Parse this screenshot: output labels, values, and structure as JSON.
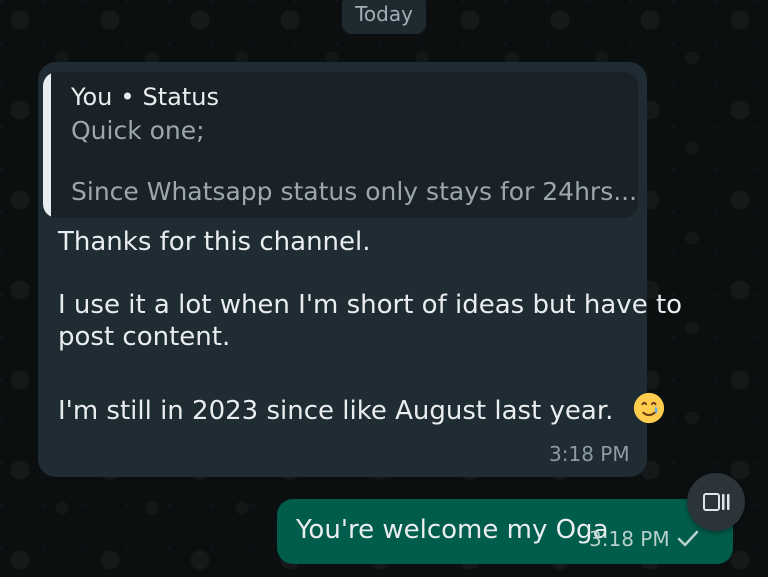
{
  "chat": {
    "date_label": "Today",
    "incoming": {
      "reply_preview": {
        "sender": "You",
        "separator": "•",
        "context": "Status",
        "line1": "Quick one;",
        "line2": "Since Whatsapp status only stays for 24hrs......"
      },
      "message_lines": [
        "Thanks for this channel.",
        "I use it a lot when I'm short of ideas but have to",
        "post content.",
        "I'm still in 2023 since like August last year."
      ],
      "emoji_icon": "smiling-face-with-tear-icon",
      "time": "3:18 PM"
    },
    "outgoing": {
      "text": "You're welcome my Oga",
      "time": "3:18 PM",
      "status_icon": "single-check-icon"
    },
    "floating_button": {
      "icon": "layout-toggle-icon"
    }
  },
  "colors": {
    "background": "#0b0f10",
    "incoming_bubble": "#1f2c33",
    "reply_card": "#1a2227",
    "outgoing_bubble": "#005c4b",
    "primary_text": "#e9edef",
    "secondary_text": "#9aa7ad"
  }
}
